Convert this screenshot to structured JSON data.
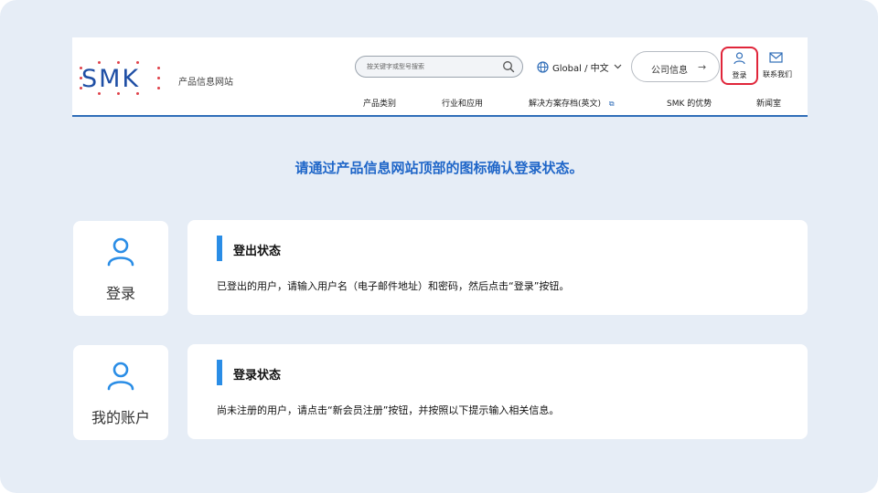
{
  "header": {
    "logo_text": "SMK",
    "site_name": "产品信息网站",
    "search_placeholder": "按关键字或型号搜索",
    "language": "Global / 中文",
    "company_info": "公司信息",
    "company_arrow": "→",
    "login_label": "登录",
    "contact_label": "联系我们",
    "nav": [
      "产品类别",
      "行业和应用",
      "解决方案存档(英文)",
      "SMK 的优势",
      "新闻室"
    ],
    "nav_external_icon": "⧉"
  },
  "headline": "请通过产品信息网站顶部的图标确认登录状态。",
  "cards": [
    {
      "icon_label": "登录",
      "title": "登出状态",
      "description": "已登出的用户，请输入用户名（电子邮件地址）和密码，然后点击“登录”按钮。"
    },
    {
      "icon_label": "我的账户",
      "title": "登录状态",
      "description": "尚未注册的用户，请点击“新会员注册”按钮，并按照以下提示输入相关信息。"
    }
  ],
  "colors": {
    "accent": "#1f66c8",
    "highlight_border": "#e0253a",
    "background": "#e6edf6",
    "bar": "#2a8de6"
  }
}
